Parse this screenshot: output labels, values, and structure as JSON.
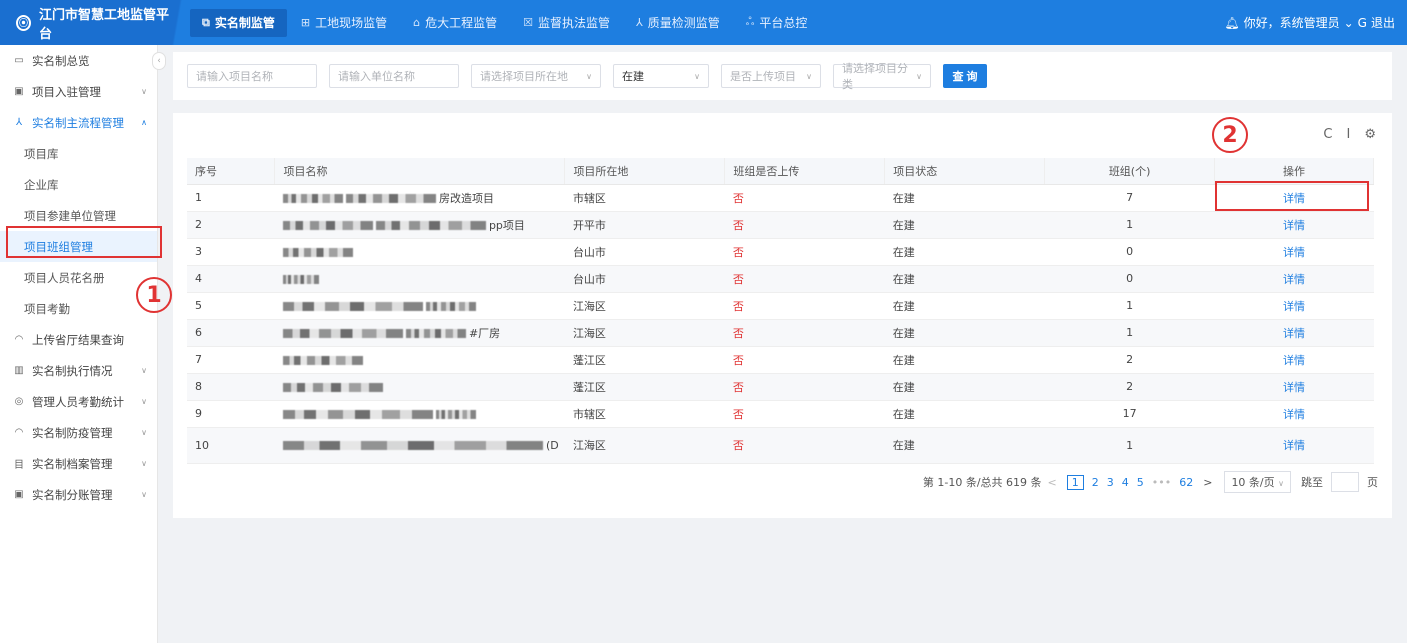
{
  "app": {
    "title": "江门市智慧工地监管平台"
  },
  "nav": {
    "items": [
      {
        "label": "实名制监管",
        "icon": "id-card-icon",
        "glyph": "⧉",
        "active": true
      },
      {
        "label": "工地现场监管",
        "icon": "grid-icon",
        "glyph": "⊞",
        "active": false
      },
      {
        "label": "危大工程监管",
        "icon": "building-icon",
        "glyph": "⌂",
        "active": false
      },
      {
        "label": "监督执法监管",
        "icon": "list-icon",
        "glyph": "☒",
        "active": false
      },
      {
        "label": "质量检测监管",
        "icon": "flask-icon",
        "glyph": "⅄",
        "active": false
      },
      {
        "label": "平台总控",
        "icon": "network-icon",
        "glyph": "ஃ",
        "active": false
      }
    ],
    "user_greeting": "你好，系统管理员",
    "logout": "退出"
  },
  "sidebar": {
    "items": [
      {
        "label": "实名制总览",
        "glyph": "▭"
      },
      {
        "label": "项目入驻管理",
        "glyph": "▣"
      },
      {
        "label": "实名制主流程管理",
        "glyph": "⅄"
      }
    ],
    "sub_items": [
      {
        "label": "项目库"
      },
      {
        "label": "企业库"
      },
      {
        "label": "项目参建单位管理"
      },
      {
        "label": "项目班组管理"
      },
      {
        "label": "项目人员花名册"
      },
      {
        "label": "项目考勤"
      }
    ],
    "lower_items": [
      {
        "label": "上传省厅结果查询",
        "glyph": "◠"
      },
      {
        "label": "实名制执行情况",
        "glyph": "▥"
      },
      {
        "label": "管理人员考勤统计",
        "glyph": "◎"
      },
      {
        "label": "实名制防疫管理",
        "glyph": "◠"
      },
      {
        "label": "实名制档案管理",
        "glyph": "目"
      },
      {
        "label": "实名制分账管理",
        "glyph": "▣"
      }
    ]
  },
  "annotations": {
    "circle_1": "1",
    "circle_2": "2"
  },
  "filters": {
    "project_name_placeholder": "请输入项目名称",
    "unit_name_placeholder": "请输入单位名称",
    "location_placeholder": "请选择项目所在地",
    "status_value": "在建",
    "uploaded_placeholder": "是否上传项目",
    "category_placeholder": "请选择项目分类",
    "query_button": "查 询"
  },
  "table": {
    "columns": [
      "序号",
      "项目名称",
      "项目所在地",
      "班组是否上传",
      "项目状态",
      "班组(个)",
      "操作"
    ],
    "rows": [
      {
        "no": "1",
        "name": "房改造项目",
        "location": "市辖区",
        "uploaded": "否",
        "status": "在建",
        "groups": "7",
        "action": "详情"
      },
      {
        "no": "2",
        "name": "pp项目",
        "location": "开平市",
        "uploaded": "否",
        "status": "在建",
        "groups": "1",
        "action": "详情"
      },
      {
        "no": "3",
        "name": "",
        "location": "台山市",
        "uploaded": "否",
        "status": "在建",
        "groups": "0",
        "action": "详情"
      },
      {
        "no": "4",
        "name": "",
        "location": "台山市",
        "uploaded": "否",
        "status": "在建",
        "groups": "0",
        "action": "详情"
      },
      {
        "no": "5",
        "name": "",
        "location": "江海区",
        "uploaded": "否",
        "status": "在建",
        "groups": "1",
        "action": "详情"
      },
      {
        "no": "6",
        "name": "#厂房",
        "location": "江海区",
        "uploaded": "否",
        "status": "在建",
        "groups": "1",
        "action": "详情"
      },
      {
        "no": "7",
        "name": "",
        "location": "蓬江区",
        "uploaded": "否",
        "status": "在建",
        "groups": "2",
        "action": "详情"
      },
      {
        "no": "8",
        "name": "",
        "location": "蓬江区",
        "uploaded": "否",
        "status": "在建",
        "groups": "2",
        "action": "详情"
      },
      {
        "no": "9",
        "name": "",
        "location": "市辖区",
        "uploaded": "否",
        "status": "在建",
        "groups": "17",
        "action": "详情"
      },
      {
        "no": "10",
        "name": "(D",
        "location": "江海区",
        "uploaded": "否",
        "status": "在建",
        "groups": "1",
        "action": "详情"
      }
    ]
  },
  "pagination": {
    "summary": "第 1-10 条/总共 619 条",
    "pages": [
      "1",
      "2",
      "3",
      "4",
      "5",
      "•••",
      "62"
    ],
    "page_size": "10 条/页",
    "jump_label": "跳至",
    "page_suffix": "页"
  }
}
